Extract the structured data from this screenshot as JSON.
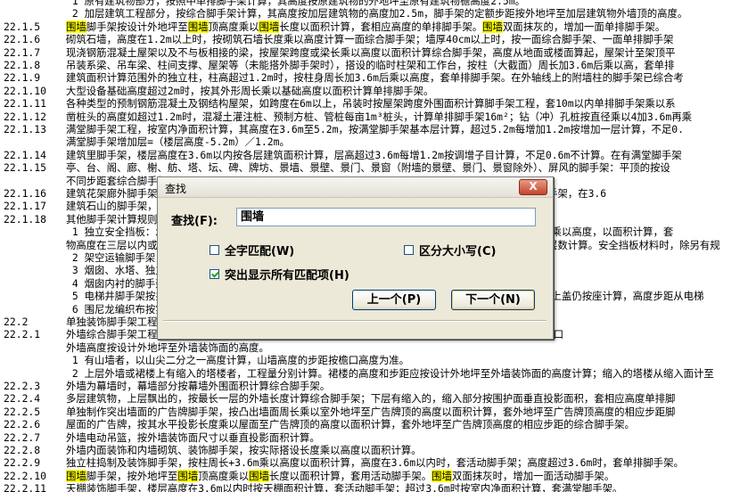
{
  "document": {
    "lines": [
      {
        "num": "",
        "parts": [
          {
            "t": "    1  原有建筑物部分，按照中单排脚手架计算，其高度按原建筑物的外地坪至原有建筑物檐高度2.5m。"
          }
        ]
      },
      {
        "num": "",
        "parts": [
          {
            "t": "    2  加层建筑工程部分，按综合脚手架计算，其高度按加层建筑物的高度加2.5m，脚手架的定额步距按外地坪至加层建筑物外墙顶的高度。"
          }
        ]
      },
      {
        "num": "22.1.5",
        "parts": [
          {
            "t": "",
            "hl": false
          },
          {
            "t": "围墙",
            "hl": true
          },
          {
            "t": "脚手架按设计外地坪至",
            "hl": false
          },
          {
            "t": "围墙",
            "hl": true
          },
          {
            "t": "顶高度乘以",
            "hl": false
          },
          {
            "t": "围墙",
            "hl": true
          },
          {
            "t": "长度以面积计算，套相应高度的单排脚手架。",
            "hl": false
          },
          {
            "t": "围墙",
            "hl": true
          },
          {
            "t": "双面抹灰的，增加一面单排脚手架。",
            "hl": false
          }
        ]
      },
      {
        "num": "22.1.6",
        "parts": [
          {
            "t": "砌筑石墙，高度在1.2m以上时，按砌筑石墙长度乘以高度计算一面综合脚手架；墙厚40cm以上时，按一面综合脚手架、一面单排脚手架"
          }
        ]
      },
      {
        "num": "22.1.7",
        "parts": [
          {
            "t": "现浇钢筋混凝土屋架以及不与板相接的梁，按屋架跨度或梁长乘以高度以面积计算综合脚手架，高度从地面或楼面算起，屋架计至架顶平"
          }
        ]
      },
      {
        "num": "22.1.8",
        "parts": [
          {
            "t": "吊装系梁、吊车梁、柱间支撑、屋架等（未能搭外脚手架时），搭设的临时柱架和工作台，按柱（大截面）周长加3.6m后乘以高，套单排"
          }
        ]
      },
      {
        "num": "22.1.9",
        "parts": [
          {
            "t": "建筑面积计算范围外的独立柱，柱高超过1.2m时，按柱身周长加3.6m后乘以高度，套单排脚手架。在外轴线上的附墙柱的脚手架已综合考"
          }
        ]
      },
      {
        "num": "22.1.10",
        "parts": [
          {
            "t": "大型设备基础高度超过2m时，按其外形周长乘以基础高度以面积计算单排脚手架。"
          }
        ]
      },
      {
        "num": "22.1.11",
        "parts": [
          {
            "t": "各种类型的预制钢筋混凝土及钢结构屋架，如跨度在6m以上，吊装时按屋架跨度外围面积计算脚手架工程，套10m以内单排脚手架乘以系"
          }
        ]
      },
      {
        "num": "22.1.12",
        "parts": [
          {
            "t": "凿桩头的高度如超过1.2m时，混凝土灌注桩、预制方桩、管桩每亩1m³桩头，计算单排脚手架16m²；钻（冲）孔桩按直径乘以4加3.6m再乘"
          }
        ]
      },
      {
        "num": "22.1.13",
        "parts": [
          {
            "t": "满堂脚手架工程，按室内净面积计算，其高度在3.6m至5.2m，按满堂脚手架基本层计算，超过5.2m每增加1.2m按增加一层计算，不足0."
          }
        ]
      },
      {
        "num": "",
        "parts": [
          {
            "t": "满堂脚手架增加层=（楼层高度-5.2m）／1.2m。"
          }
        ]
      },
      {
        "num": "22.1.14",
        "parts": [
          {
            "t": "建筑里脚手架，楼层高度在3.6m以内按各层建筑面积计算，层高超过3.6m每增1.2m按调增子目计算，不足0.6m不计算。在有满堂脚手架"
          }
        ]
      },
      {
        "num": "22.1.15",
        "parts": [
          {
            "t": "亭、台、阁、廊、榭、舫、塔、坛、碑、牌坊、景墙、景壁、景门、景窗（附墙的景壁、景门、景窗除外）、屏风的脚手架：平顶的按设"
          }
        ]
      },
      {
        "num": "",
        "parts": [
          {
            "t": "不同步距套综合脚手架子目。"
          }
        ]
      },
      {
        "num": "22.1.16",
        "parts": [
          {
            "t": "建筑花架廊外脚手架，按搭设长度乘以高度以面积计算，套相应高度的脚手架，高度在3.6m以内套用单排脚手架，在3.6"
          }
        ]
      },
      {
        "num": "22.1.17",
        "parts": [
          {
            "t": "建筑石山的脚手架，按外围水平投影最大矩形面积计算，以高度以面积计算，套用综合脚手架定额，"
          }
        ]
      },
      {
        "num": "22.1.18",
        "parts": [
          {
            "t": "其他脚手架计算规则。"
          }
        ]
      },
      {
        "num": "",
        "parts": [
          {
            "t": "    1  独立安全挡板：水平挡板按水平投影面积计算，垂直挡板按实际搭设长度，以高度计算，以实际搭设长度乘以高度，以面积计算，套"
          }
        ]
      },
      {
        "num": "",
        "parts": [
          {
            "t": "物高度在三层以内或9m范围内。超过9m的，按实际搭设层数计算，层数超过三层时，按每增加一层计算，以层数计算。安全挡板材料时，除另有规"
          }
        ]
      },
      {
        "num": "",
        "parts": [
          {
            "t": "    2  架空运输脚手架，按搭设长度以延长米计算。"
          }
        ]
      },
      {
        "num": "",
        "parts": [
          {
            "t": "    3  烟囱、水塔、独立筒仓脚手架，分别按不同高度，以座计算。"
          }
        ]
      },
      {
        "num": "",
        "parts": [
          {
            "t": "    4  烟囱内衬的脚手架，按烟囱内衬砌体的面积计算。"
          }
        ]
      },
      {
        "num": "",
        "parts": [
          {
            "t": "    5  电梯井脚手架按井底板面至顶层顶板面的高度计算，以座计算，井道顶板以上为机房等需搭设脚手架的，上盖仍按座计算，高度步距从电梯"
          }
        ]
      },
      {
        "num": "",
        "parts": [
          {
            "t": "    6  围尼龙编织布按实搭面积计算。"
          }
        ]
      },
      {
        "num": "22.2",
        "parts": [
          {
            "t": "单独装饰脚手架工程"
          }
        ]
      },
      {
        "num": "22.2.1",
        "parts": [
          {
            "t": "外墙综合脚手架工程，按外墙外边线长度乘以设计外地坪至外墙装饰面的高度以面积计算；不扣除门、窗、洞口"
          }
        ]
      },
      {
        "num": "",
        "parts": [
          {
            "t": "外墙高度按设计外地坪至外墙装饰面的高度。"
          }
        ]
      },
      {
        "num": "",
        "parts": [
          {
            "t": "    1  有山墙者，以山尖二分之一高度计算，山墙高度的步距按檐口高度为准。"
          }
        ]
      },
      {
        "num": "",
        "parts": [
          {
            "t": "    2  上层外墙或裙楼上有缩入的塔楼者，工程量分别计算。裙楼的高度和步距应按设计外地坪至外墙装饰面的高度计算；缩入的塔楼从缩入面计至"
          }
        ]
      },
      {
        "num": "22.2.3",
        "parts": [
          {
            "t": "外墙为幕墙时，幕墙部分按幕墙外围面积计算综合脚手架。"
          }
        ]
      },
      {
        "num": "22.2.4",
        "parts": [
          {
            "t": "多层建筑物，上层飘出的，按最长一层的外墙长度计算综合脚手架；下层有缩入的，缩入部分按围护面垂直投影面积，套相应高度单排脚"
          }
        ]
      },
      {
        "num": "22.2.5",
        "parts": [
          {
            "t": "单独制作突出墙面的广告牌脚手架，按凸出墙面周长乘以室外地坪至广告牌顶的高度以面积计算，套外地坪至广告牌顶高度的相应步距脚"
          }
        ]
      },
      {
        "num": "22.2.6",
        "parts": [
          {
            "t": "屋面的广告牌，按其水平投影长度乘以屋面至广告牌顶的高度以面积计算，套外地坪至广告牌顶高度的相应步距的综合脚手架。"
          }
        ]
      },
      {
        "num": "22.2.7",
        "parts": [
          {
            "t": "外墙电动吊篮，按外墙装饰面尺寸以垂直投影面积计算。"
          }
        ]
      },
      {
        "num": "22.2.8",
        "parts": [
          {
            "t": "外墙内面装饰和内墙砌筑、装饰脚手架，按实际搭设长度乘以高度以面积计算。"
          }
        ]
      },
      {
        "num": "22.2.9",
        "parts": [
          {
            "t": "独立柱捣制及装饰脚手架，按柱周长+3.6m乘以高度以面积计算，高度在3.6m以内时，套活动脚手架；高度超过3.6m时，套单排脚手架。"
          }
        ]
      },
      {
        "num": "22.2.10",
        "parts": [
          {
            "t": "",
            "hl": false
          },
          {
            "t": "围墙",
            "hl": true
          },
          {
            "t": "脚手架，按外地坪至",
            "hl": false
          },
          {
            "t": "围墙",
            "hl": true
          },
          {
            "t": "顶高度乘以",
            "hl": false
          },
          {
            "t": "围墙",
            "hl": true
          },
          {
            "t": "长度以面积计算，套用活动脚手架。",
            "hl": false
          },
          {
            "t": "围墙",
            "hl": true
          },
          {
            "t": "双面抹灰时，增加一面活动脚手架。",
            "hl": false
          }
        ]
      },
      {
        "num": "22.2.11",
        "parts": [
          {
            "t": "天棚装饰脚手架，楼层高度在3.6m以内时按天棚面积计算，套活动脚手架；超过3.6m时按室内净面积计算，套满堂脚手架。"
          }
        ]
      }
    ]
  },
  "find_dialog": {
    "title": "查找",
    "close_label": "X",
    "find_label": "查找(F):",
    "find_value": "围墙",
    "whole_word_label": "全字匹配(W)",
    "whole_word_checked": false,
    "match_case_label": "区分大小写(C)",
    "match_case_checked": false,
    "highlight_all_label": "突出显示所有匹配项(H)",
    "highlight_all_checked": true,
    "prev_label": "上一个(P)",
    "next_label": "下一个(N)"
  },
  "colors": {
    "highlight": "#ffff00",
    "dialog_bg": "#ece9d8",
    "close_button": "#c4452c"
  }
}
